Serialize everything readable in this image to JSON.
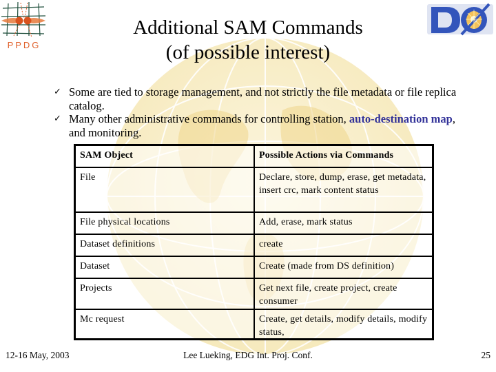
{
  "slide": {
    "title_line1": "Additional SAM Commands",
    "title_line2": "(of possible interest)",
    "logos": {
      "left": "PPDG",
      "right": "DØ"
    },
    "bullets": [
      {
        "icon": "check-icon",
        "text": "Some are tied to storage management, and not strictly the file metadata or file replica catalog."
      },
      {
        "icon": "check-icon",
        "text_before": "Many other administrative commands for controlling station, ",
        "highlight": "auto-destination map",
        "text_after": ", and monitoring.",
        "highlight_color": "#333399"
      }
    ],
    "table": {
      "headers": [
        "SAM Object",
        "Possible Actions via Commands"
      ],
      "rows": [
        [
          "File",
          "Declare, store, dump, erase, get metadata, insert crc, mark content status"
        ],
        [
          "File physical locations",
          "Add, erase, mark status"
        ],
        [
          "Dataset definitions",
          "create"
        ],
        [
          "Dataset",
          "Create (made from DS definition)"
        ],
        [
          "Projects",
          "Get next file, create project, create consumer"
        ],
        [
          "Mc request",
          "Create, get details, modify details, modify status,"
        ]
      ]
    },
    "footer": {
      "date": "12-16 May, 2003",
      "center": "Lee Lueking, EDG Int. Proj. Conf.",
      "page_number": "25"
    },
    "colors": {
      "globe": "#f7e9b8",
      "accent": "#333399",
      "ppdg_orange": "#e0602a",
      "d0_blue": "#3355bb"
    }
  }
}
